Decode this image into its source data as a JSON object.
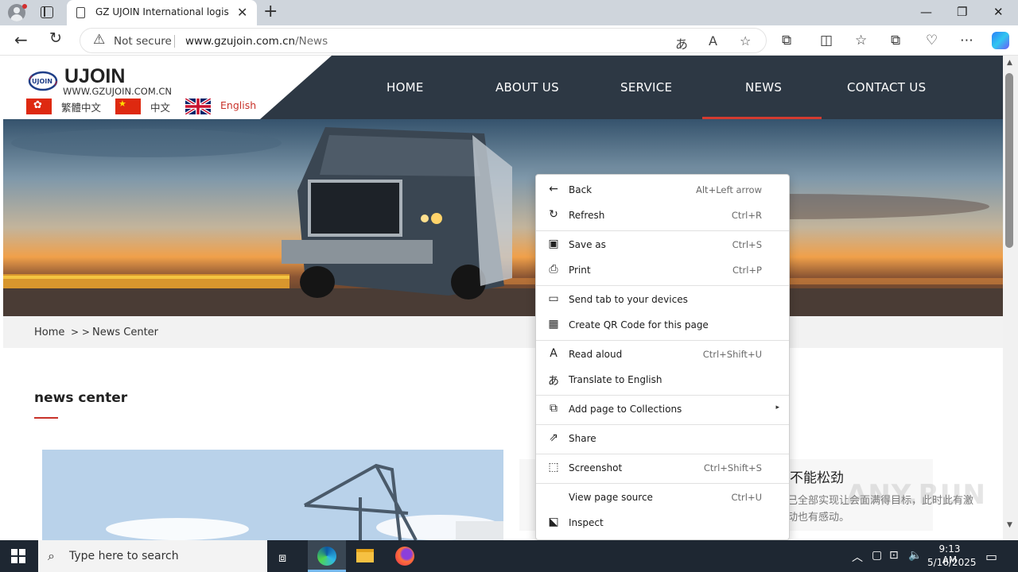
{
  "browser": {
    "tab_title": "GZ UJOIN International logistics Co.",
    "tab_close": "✕",
    "new_tab": "+",
    "window_minimize": "—",
    "window_maximize": "❐",
    "window_close": "✕",
    "security_label": "Not secure",
    "url_host": "www.gzujoin.com.cn",
    "url_path": "/News"
  },
  "site": {
    "brand": "UJOIN",
    "brand_url": "WWW.GZUJOIN.COM.CN",
    "languages": [
      {
        "label": "繁體中文"
      },
      {
        "label": "中文"
      },
      {
        "label": "English"
      }
    ],
    "nav": [
      "HOME",
      "ABOUT US",
      "SERVICE",
      "NEWS",
      "CONTACT US"
    ],
    "active_nav": "NEWS",
    "accent_color": "#d43b30",
    "nav_bg_color": "#2d3844",
    "breadcrumb": {
      "home": "Home",
      "separator": "> >",
      "current": "News Center"
    },
    "section_title": "news center",
    "news_headline_fragment": "不能松劲",
    "news_excerpt_fragment": "已全部实现让会面满得目标，此时此有激动也有感动。",
    "watermark": "ANY.RUN"
  },
  "context_menu": {
    "items": [
      {
        "label": "Back",
        "shortcut": "Alt+Left arrow",
        "icon": "back-arrow-icon"
      },
      {
        "label": "Refresh",
        "shortcut": "Ctrl+R",
        "icon": "refresh-icon"
      },
      {
        "label": "Save as",
        "shortcut": "Ctrl+S",
        "icon": "save-as-icon"
      },
      {
        "label": "Print",
        "shortcut": "Ctrl+P",
        "icon": "print-icon"
      },
      {
        "label": "Send tab to your devices",
        "shortcut": "",
        "icon": "send-tab-icon"
      },
      {
        "label": "Create QR Code for this page",
        "shortcut": "",
        "icon": "qr-code-icon"
      },
      {
        "label": "Read aloud",
        "shortcut": "Ctrl+Shift+U",
        "icon": "read-aloud-icon"
      },
      {
        "label": "Translate to English",
        "shortcut": "",
        "icon": "translate-icon"
      },
      {
        "label": "Add page to Collections",
        "shortcut": "",
        "icon": "collections-icon",
        "submenu": "▸"
      },
      {
        "label": "Share",
        "shortcut": "",
        "icon": "share-icon"
      },
      {
        "label": "Screenshot",
        "shortcut": "Ctrl+Shift+S",
        "icon": "screenshot-icon"
      },
      {
        "label": "View page source",
        "shortcut": "Ctrl+U",
        "icon": ""
      },
      {
        "label": "Inspect",
        "shortcut": "",
        "icon": "inspect-icon"
      }
    ]
  },
  "taskbar": {
    "search_placeholder": "Type here to search",
    "time": "9:13 AM",
    "date": "5/16/2025"
  }
}
